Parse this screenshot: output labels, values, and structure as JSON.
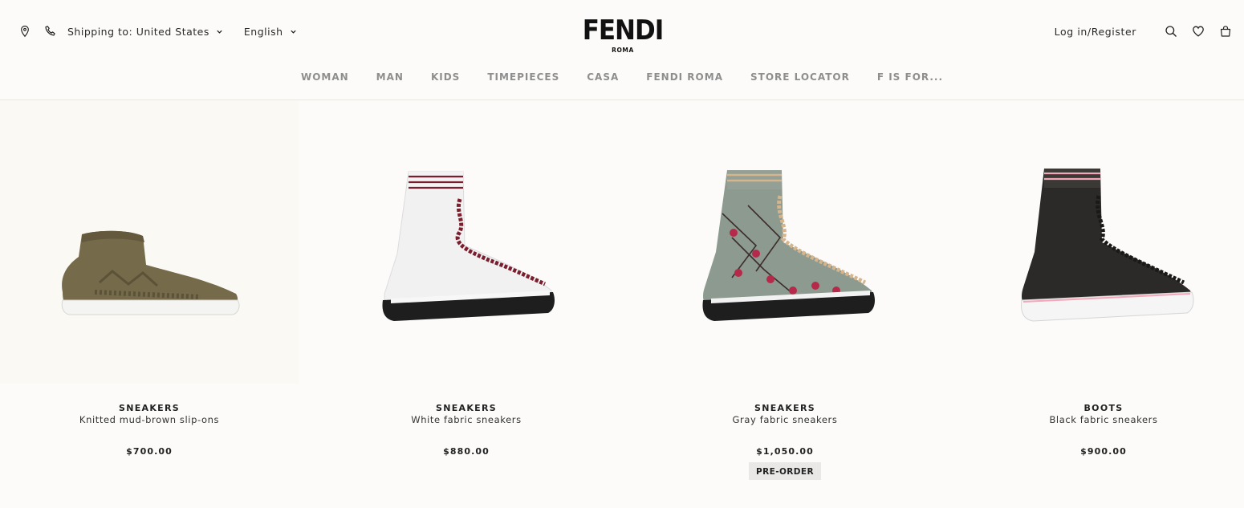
{
  "header": {
    "location_icon": "map-pin-icon",
    "phone_icon": "phone-icon",
    "shipping_label": "Shipping to: United States",
    "language_label": "English",
    "logo_text": "FENDI",
    "logo_sub": "ROMA",
    "login_label": "Log in/Register",
    "search_icon": "search-icon",
    "wishlist_icon": "heart-icon",
    "bag_icon": "shopping-bag-icon"
  },
  "nav": {
    "items": [
      "WOMAN",
      "MAN",
      "KIDS",
      "TIMEPIECES",
      "CASA",
      "FENDI ROMA",
      "STORE LOCATOR",
      "F IS FOR..."
    ]
  },
  "products": [
    {
      "category": "SNEAKERS",
      "name": "Knitted mud-brown slip-ons",
      "price": "$700.00",
      "badge": "",
      "color": "#756a4a"
    },
    {
      "category": "SNEAKERS",
      "name": "White fabric sneakers",
      "price": "$880.00",
      "badge": "",
      "color": "#f1f1f2"
    },
    {
      "category": "SNEAKERS",
      "name": "Gray fabric sneakers",
      "price": "$1,050.00",
      "badge": "PRE-ORDER",
      "color": "#8d9a8f"
    },
    {
      "category": "BOOTS",
      "name": "Black fabric sneakers",
      "price": "$900.00",
      "badge": "",
      "color": "#2b2a28"
    }
  ]
}
